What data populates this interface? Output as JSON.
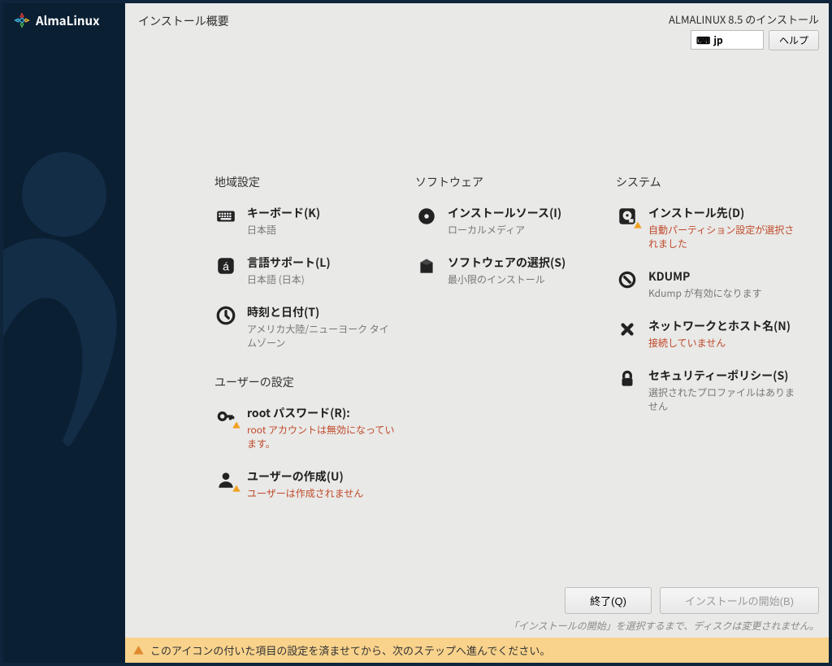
{
  "brand": "AlmaLinux",
  "header": {
    "title": "インストール概要",
    "product": "ALMALINUX 8.5 のインストール",
    "keyboard_layout": "jp",
    "help_label": "ヘルプ"
  },
  "categories": [
    {
      "title": "地域設定",
      "spokes": [
        {
          "icon": "keyboard",
          "label": "キーボード(K)",
          "status": "日本語",
          "warn": false
        },
        {
          "icon": "lang",
          "label": "言語サポート(L)",
          "status": "日本語 (日本)",
          "warn": false
        },
        {
          "icon": "clock",
          "label": "時刻と日付(T)",
          "status": "アメリカ大陸/ニューヨーク タイムゾーン",
          "warn": false
        }
      ]
    },
    {
      "title": "ソフトウェア",
      "spokes": [
        {
          "icon": "disc",
          "label": "インストールソース(I)",
          "status": "ローカルメディア",
          "warn": false
        },
        {
          "icon": "box",
          "label": "ソフトウェアの選択(S)",
          "status": "最小限のインストール",
          "warn": false
        }
      ]
    },
    {
      "title": "システム",
      "spokes": [
        {
          "icon": "disk",
          "label": "インストール先(D)",
          "status": "自動パーティション設定が選択されました",
          "warn": true,
          "icon_warn": true
        },
        {
          "icon": "wrench",
          "label": "KDUMP",
          "status": "Kdump が有効になります",
          "warn": false
        },
        {
          "icon": "network",
          "label": "ネットワークとホスト名(N)",
          "status": "接続していません",
          "warn": true
        },
        {
          "icon": "lock",
          "label": "セキュリティーポリシー(S)",
          "status": "選択されたプロファイルはありません",
          "warn": false
        }
      ]
    },
    {
      "title": "ユーザーの設定",
      "spokes": [
        {
          "icon": "key",
          "label": "root パスワード(R):",
          "status": "root アカウントは無効になっています。",
          "warn": true,
          "icon_warn": true
        },
        {
          "icon": "user",
          "label": "ユーザーの作成(U)",
          "status": "ユーザーは作成されません",
          "warn": true,
          "icon_warn": true
        }
      ]
    }
  ],
  "footer": {
    "quit_label": "終了(Q)",
    "begin_label": "インストールの開始(B)",
    "hint": "「インストールの開始」を選択するまで、ディスクは変更されません。"
  },
  "info_bar": "このアイコンの付いた項目の設定を済ませてから、次のステップへ進んでください。"
}
